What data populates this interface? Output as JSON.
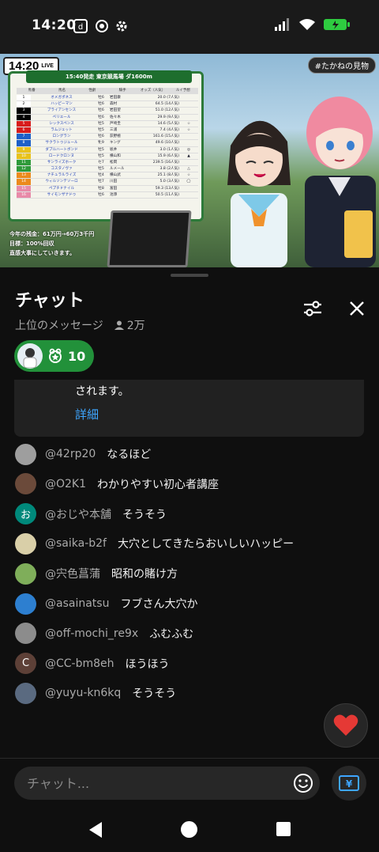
{
  "status_bar": {
    "time": "14:20"
  },
  "video": {
    "live_time": "14:20",
    "live_label": "LIVE",
    "hashtag": "#たかねの見物",
    "board_title": "15:40発走 東京競馬場 ダ1600m",
    "board_columns": [
      "馬番",
      "馬名",
      "性齢",
      "騎手",
      "オッズ（人気）",
      "ルイ予想"
    ],
    "races": [
      {
        "num": "1",
        "name": "オメガポネス",
        "sex": "牡6",
        "jockey": "岩田康",
        "odds": "20.0 (7人気)",
        "mark": "",
        "color": "#ffffff"
      },
      {
        "num": "2",
        "name": "ハッピーマン",
        "sex": "牡6",
        "jockey": "森村",
        "odds": "64.5 (14人気)",
        "mark": "",
        "color": "#ffffff"
      },
      {
        "num": "3",
        "name": "ブライアンセンス",
        "sex": "牡6",
        "jockey": "岩田望",
        "odds": "51.0 (12人気)",
        "mark": "",
        "color": "#000000"
      },
      {
        "num": "4",
        "name": "ペリエール",
        "sex": "牡6",
        "jockey": "佐々木",
        "odds": "29.9 (9人気)",
        "mark": "",
        "color": "#000000"
      },
      {
        "num": "5",
        "name": "シックスペンス",
        "sex": "牡5",
        "jockey": "戸崎圭",
        "odds": "14.6 (5人気)",
        "mark": "☆",
        "color": "#d81c1c"
      },
      {
        "num": "6",
        "name": "ラムジェット",
        "sex": "牡5",
        "jockey": "三浦",
        "odds": "7.4 (4人気)",
        "mark": "☆",
        "color": "#d81c1c"
      },
      {
        "num": "7",
        "name": "ロングラン",
        "sex": "牡6",
        "jockey": "荻野極",
        "odds": "161.6 (15人気)",
        "mark": "",
        "color": "#1d5fc8"
      },
      {
        "num": "8",
        "name": "サクラトゥジュール",
        "sex": "牝9",
        "jockey": "キング",
        "odds": "49.6 (10人気)",
        "mark": "",
        "color": "#1d5fc8"
      },
      {
        "num": "9",
        "name": "ダブルハートボンド",
        "sex": "牡5",
        "jockey": "坂井",
        "odds": "3.0 (1人気)",
        "mark": "◎",
        "color": "#e8c21c"
      },
      {
        "num": "10",
        "name": "ロードクロンヌ",
        "sex": "牡5",
        "jockey": "横山和",
        "odds": "15.9 (6人気)",
        "mark": "▲",
        "color": "#e8c21c"
      },
      {
        "num": "11",
        "name": "サンライズホーク",
        "sex": "セ7",
        "jockey": "松岡",
        "odds": "239.5 (16人気)",
        "mark": "",
        "color": "#2f9a3a"
      },
      {
        "num": "12",
        "name": "コスタノヴァ",
        "sex": "牡5",
        "jockey": "ルメール",
        "odds": "3.8 (2人気)",
        "mark": "△",
        "color": "#2f9a3a"
      },
      {
        "num": "13",
        "name": "ナチュラルライズ",
        "sex": "牡4",
        "jockey": "横山武",
        "odds": "25.1 (8人気)",
        "mark": "☆",
        "color": "#ec8a1c"
      },
      {
        "num": "14",
        "name": "ウィルソンテソーロ",
        "sex": "牡7",
        "jockey": "川田",
        "odds": "5.0 (3人気)",
        "mark": "◯",
        "color": "#ec8a1c"
      },
      {
        "num": "15",
        "name": "ペプチドナイル",
        "sex": "牡8",
        "jockey": "富田",
        "odds": "59.3 (13人気)",
        "mark": "",
        "color": "#e88aa8"
      },
      {
        "num": "16",
        "name": "サイモンザナドゥ",
        "sex": "牡6",
        "jockey": "池添",
        "odds": "50.5 (11人気)",
        "mark": "",
        "color": "#e88aa8"
      }
    ],
    "overlay_lines": [
      "今年の残金：61万円→60万3千円",
      "目標：100%回収",
      "直感大事にしていきます。"
    ]
  },
  "chat": {
    "title": "チャット",
    "subtitle": "上位のメッセージ",
    "viewer_count": "2万",
    "pill_count": "10",
    "notice_text": "されます。",
    "notice_link": "詳細",
    "messages": [
      {
        "user": "@42rp20",
        "text": "なるほど",
        "avatar_color": "#9e9e9e",
        "avatar_letter": ""
      },
      {
        "user": "@O2K1",
        "text": "わかりやすい初心者講座",
        "avatar_color": "#6b4a3a",
        "avatar_letter": ""
      },
      {
        "user": "@おじや本舗",
        "text": "そうそう",
        "avatar_color": "#00897b",
        "avatar_letter": "お"
      },
      {
        "user": "@saika-b2f",
        "text": "大穴としてきたらおいしいハッピー",
        "avatar_color": "#d9cfa8",
        "avatar_letter": ""
      },
      {
        "user": "@宍色菖蒲",
        "text": "昭和の賭け方",
        "avatar_color": "#7fae5a",
        "avatar_letter": ""
      },
      {
        "user": "@asainatsu",
        "text": "フブさん大穴か",
        "avatar_color": "#2d7fd0",
        "avatar_letter": ""
      },
      {
        "user": "@off-mochi_re9x",
        "text": "ふむふむ",
        "avatar_color": "#8c8c8c",
        "avatar_letter": ""
      },
      {
        "user": "@CC-bm8eh",
        "text": "ほうほう",
        "avatar_color": "#5d4037",
        "avatar_letter": "C"
      },
      {
        "user": "@yuyu-kn6kq",
        "text": "そうそう",
        "avatar_color": "#5a6a80",
        "avatar_letter": ""
      }
    ],
    "input_placeholder": "チャット..."
  },
  "icons": {
    "wifi": "wifi-icon",
    "battery": "battery-icon",
    "settings_filter": "sliders-icon",
    "close": "close-icon",
    "heart": "heart-icon",
    "emoji": "smiley-icon",
    "super_chat": "yen-icon"
  },
  "colors": {
    "accent_green": "#22913a",
    "link_blue": "#3ea6ff",
    "heart_red": "#e53935"
  }
}
